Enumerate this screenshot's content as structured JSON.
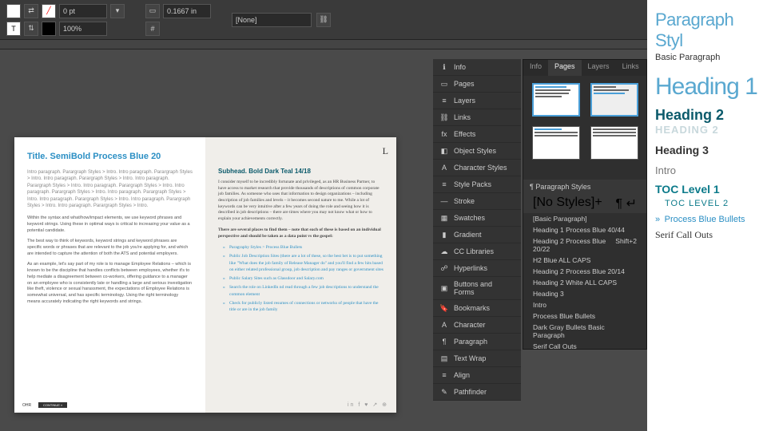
{
  "toolbar": {
    "stroke_pt": "0 pt",
    "val1": "0.1667 in",
    "zoom": "100%",
    "style_dropdown": "[None]"
  },
  "panels": {
    "tabs": [
      "Info",
      "Pages",
      "Layers",
      "Links"
    ],
    "active_tab": "Pages"
  },
  "right_strip": [
    {
      "icon": "ℹ",
      "label": "Info"
    },
    {
      "icon": "▭",
      "label": "Pages"
    },
    {
      "icon": "≡",
      "label": "Layers"
    },
    {
      "icon": "⛓",
      "label": "Links"
    },
    {
      "icon": "fx",
      "label": "Effects"
    },
    {
      "icon": "◧",
      "label": "Object Styles"
    },
    {
      "icon": "A",
      "label": "Character Styles"
    },
    {
      "icon": "≡",
      "label": "Style Packs"
    },
    {
      "icon": "—",
      "label": "Stroke"
    },
    {
      "icon": "▦",
      "label": "Swatches"
    },
    {
      "icon": "▮",
      "label": "Gradient"
    },
    {
      "icon": "☁",
      "label": "CC Libraries"
    },
    {
      "icon": "☍",
      "label": "Hyperlinks"
    },
    {
      "icon": "▣",
      "label": "Buttons and Forms"
    },
    {
      "icon": "🔖",
      "label": "Bookmarks"
    },
    {
      "icon": "A",
      "label": "Character"
    },
    {
      "icon": "¶",
      "label": "Paragraph"
    },
    {
      "icon": "▤",
      "label": "Text Wrap"
    },
    {
      "icon": "≡",
      "label": "Align"
    },
    {
      "icon": "✎",
      "label": "Pathfinder"
    }
  ],
  "para_styles": {
    "header": "Paragraph Styles",
    "current": "[No Styles]+",
    "items": [
      {
        "name": "[Basic Paragraph]",
        "shortcut": ""
      },
      {
        "name": "Heading 1 Process Blue 40/44",
        "shortcut": ""
      },
      {
        "name": "Heading 2 Process Blue 20/22",
        "shortcut": "Shift+2"
      },
      {
        "name": "H2 Blue ALL CAPS",
        "shortcut": ""
      },
      {
        "name": "Heading 2 Process Blue 20/14",
        "shortcut": ""
      },
      {
        "name": "Heading 2 White ALL CAPS",
        "shortcut": ""
      },
      {
        "name": "Heading 3",
        "shortcut": ""
      },
      {
        "name": "Intro",
        "shortcut": ""
      },
      {
        "name": "Process Blue Bullets",
        "shortcut": ""
      },
      {
        "name": "Dark Gray Bullets Basic Paragraph",
        "shortcut": ""
      },
      {
        "name": "Serif Call Outs",
        "shortcut": ""
      },
      {
        "name": "TOC Level 1",
        "shortcut": ""
      },
      {
        "name": "TOC Level 2",
        "shortcut": ""
      }
    ]
  },
  "doc": {
    "title": "Title. SemiBold Process Blue 20",
    "intro": "Intro paragraph. Parargraph Styles > Intro. Intro paragraph. Parargraph Styles > Intro. Intro paragraph. Parargraph Styles > Intro. Intro paragraph. Parargraph Styles > Intro. Intro paragraph. Parargraph Styles > Intro. Intro paragraph. Parargraph Styles > Intro. Intro paragraph. Parargraph Styles > Intro. Intro paragraph. Parargraph Styles > Intro. Intro paragraph. Parargraph Styles > Intro. Intro paragraph. Parargraph Styles > Intro.",
    "body1": "Within the syntax and what/how/impact elements, we use keyword phrases and keyword strings. Using these in optimal ways is critical to increasing your value as a potential candidate.",
    "body2": "The best way to think of keywords, keyword strings and keyword phrases are specific words or phrases that are relevant to the job you're applying for, and which are intended to capture the attention of both the ATS and potential employers.",
    "body3": "As an example, let's say part of my role is to manage Employee Relations – which is known to be the discipline that handles conflicts between employees, whether it's to help mediate a disagreement between co-workers, offering guidance to a manager on an employee who is consistently late or handling a large and serious investigation like theft, violence or sexual harassment, the expectations of Employee Relations is somewhat universal, and has specific terminology. Using the right terminology means accurately indicating the right keywords and strings.",
    "subhead": "Subhead. Bold Dark Teal 14/18",
    "serif1": "I consider myself to be incredibly fortunate and privileged, as an HR Business Partner, to have access to market research that provide thousands of descriptions of common corporate job families. As someone who uses that information to design organizations – including description of job families and levels – it becomes second nature to me. While a lot of keywords can be very intuitive after a few years of doing the role and seeing how it is described in job descriptions – there are times where you may not know what or how to explain your achievements correctly.",
    "serif2": "There are several places to find them – note that each of these is based on an individual perspective and should be taken as a data point vs the gospel:",
    "bullets": [
      "Paragraphy Styles > Process Blue Bullets",
      "Public Job Description Sites (there are a lot of these, so the best bet is to put something like \"What does the job family of Release Manager do\" and you'll find a few hits based on either related professional group, job description and pay ranges or government sites",
      "Public Salary Sites such as Glassdoor and Salary.com",
      "Search the role on LinkedIn nd read through a few job descriptions to understand the common element",
      "Check for publicly listed resumes of connections or networks of people that have the title or are in the job family"
    ],
    "cornerL": "L",
    "continue": "CONTINUE »"
  },
  "preview": {
    "heading": "Paragraph Styl",
    "basic": "Basic Paragraph",
    "h1": "Heading 1",
    "h2": "Heading 2",
    "h2caps": "HEADING 2",
    "h3": "Heading 3",
    "intro": "Intro",
    "toc1": "TOC Level 1",
    "toc2": "TOC LEVEL 2",
    "bullet_prefix": "»",
    "bullets": "Process Blue Bullets",
    "serif": "Serif Call Outs"
  }
}
